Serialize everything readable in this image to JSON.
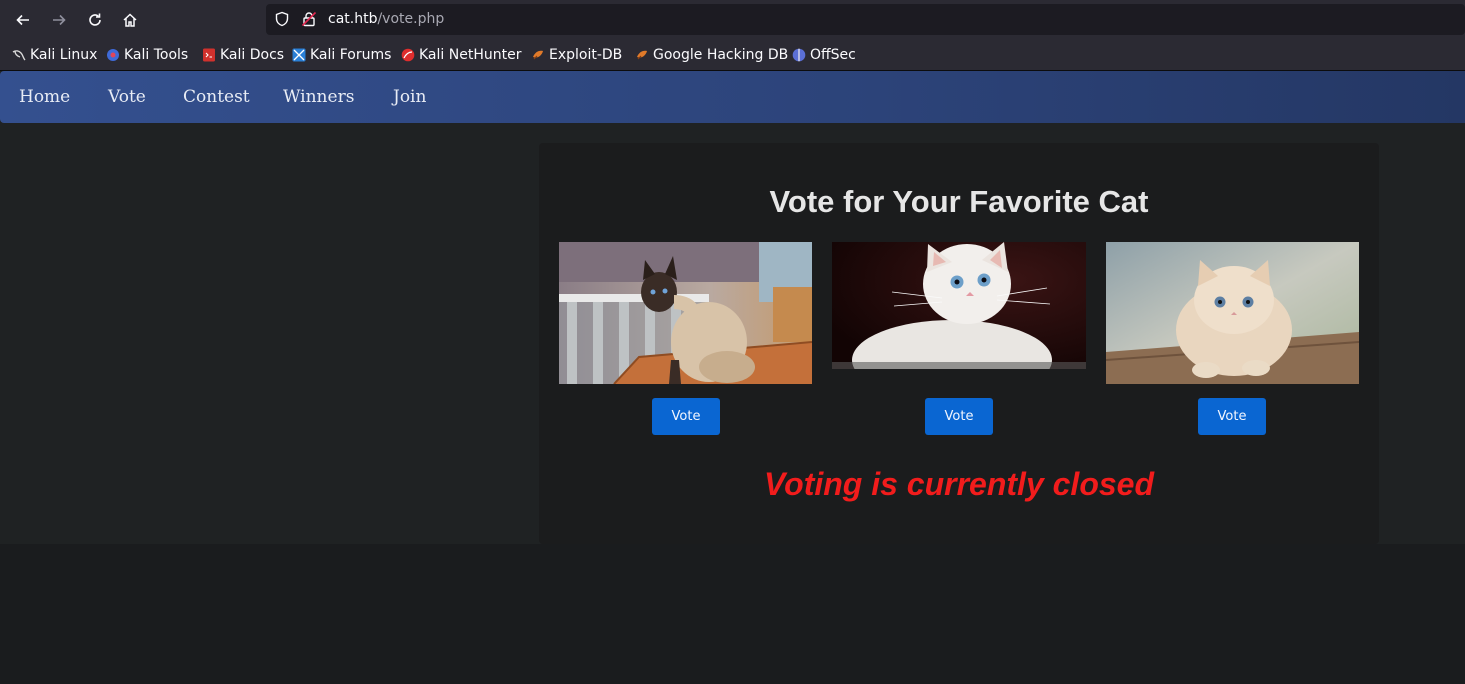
{
  "browser": {
    "url_host": "cat.htb",
    "url_path": "/vote.php",
    "bookmarks": [
      {
        "label": "Kali Linux",
        "color": "#1c1c1c"
      },
      {
        "label": "Kali Tools",
        "color": "#3f6ad8"
      },
      {
        "label": "Kali Docs",
        "color": "#d0312d"
      },
      {
        "label": "Kali Forums",
        "color": "#2a7fd6"
      },
      {
        "label": "Kali NetHunter",
        "color": "#e02d2d"
      },
      {
        "label": "Exploit-DB",
        "color": "#e07a2a"
      },
      {
        "label": "Google Hacking DB",
        "color": "#e07a2a"
      },
      {
        "label": "OffSec",
        "color": "#5b6fd6"
      }
    ]
  },
  "site": {
    "nav": [
      "Home",
      "Vote",
      "Contest",
      "Winners",
      "Join"
    ],
    "title": "Vote for Your Favorite Cat",
    "cats": [
      {
        "vote_label": "Vote"
      },
      {
        "vote_label": "Vote"
      },
      {
        "vote_label": "Vote"
      }
    ],
    "status": "Voting is currently closed",
    "colors": {
      "navbar": "#34508f",
      "vote_button": "#0a66d2",
      "status": "#f21c1c"
    }
  }
}
